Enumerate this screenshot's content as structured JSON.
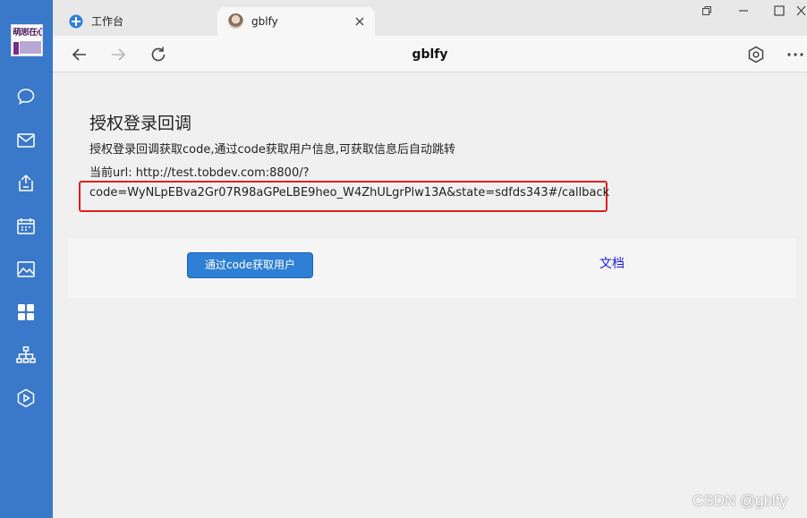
{
  "rail": {
    "logo_text": "萌思在心",
    "icons": [
      "chat-icon",
      "mail-icon",
      "share-icon",
      "calendar-icon",
      "image-icon",
      "apps-icon",
      "org-chart-icon",
      "play-icon"
    ]
  },
  "tabs": [
    {
      "title": "工作台",
      "icon": "workbench-icon",
      "active": false
    },
    {
      "title": "gblfy",
      "icon": "avatar-icon",
      "active": true
    }
  ],
  "toolbar": {
    "title": "gblfy"
  },
  "page": {
    "title": "授权登录回调",
    "description": "授权登录回调获取code,通过code获取用户信息,可获取信息后自动跳转",
    "url_prefix": "当前url: http://test.tobdev.com:8800/?",
    "url_query": "code=WyNLpEBva2Gr07R98aGPeLBE9heo_W4ZhULgrPlw13A&state=sdfds343#/callback"
  },
  "actions": {
    "get_user_button": "通过code获取用户",
    "doc_link": "文档"
  },
  "watermark": "CSDN @gblfy",
  "colors": {
    "rail": "#3a78c9",
    "button": "#2f7fd4",
    "highlight": "#e02020",
    "link": "#1a1ae6"
  }
}
